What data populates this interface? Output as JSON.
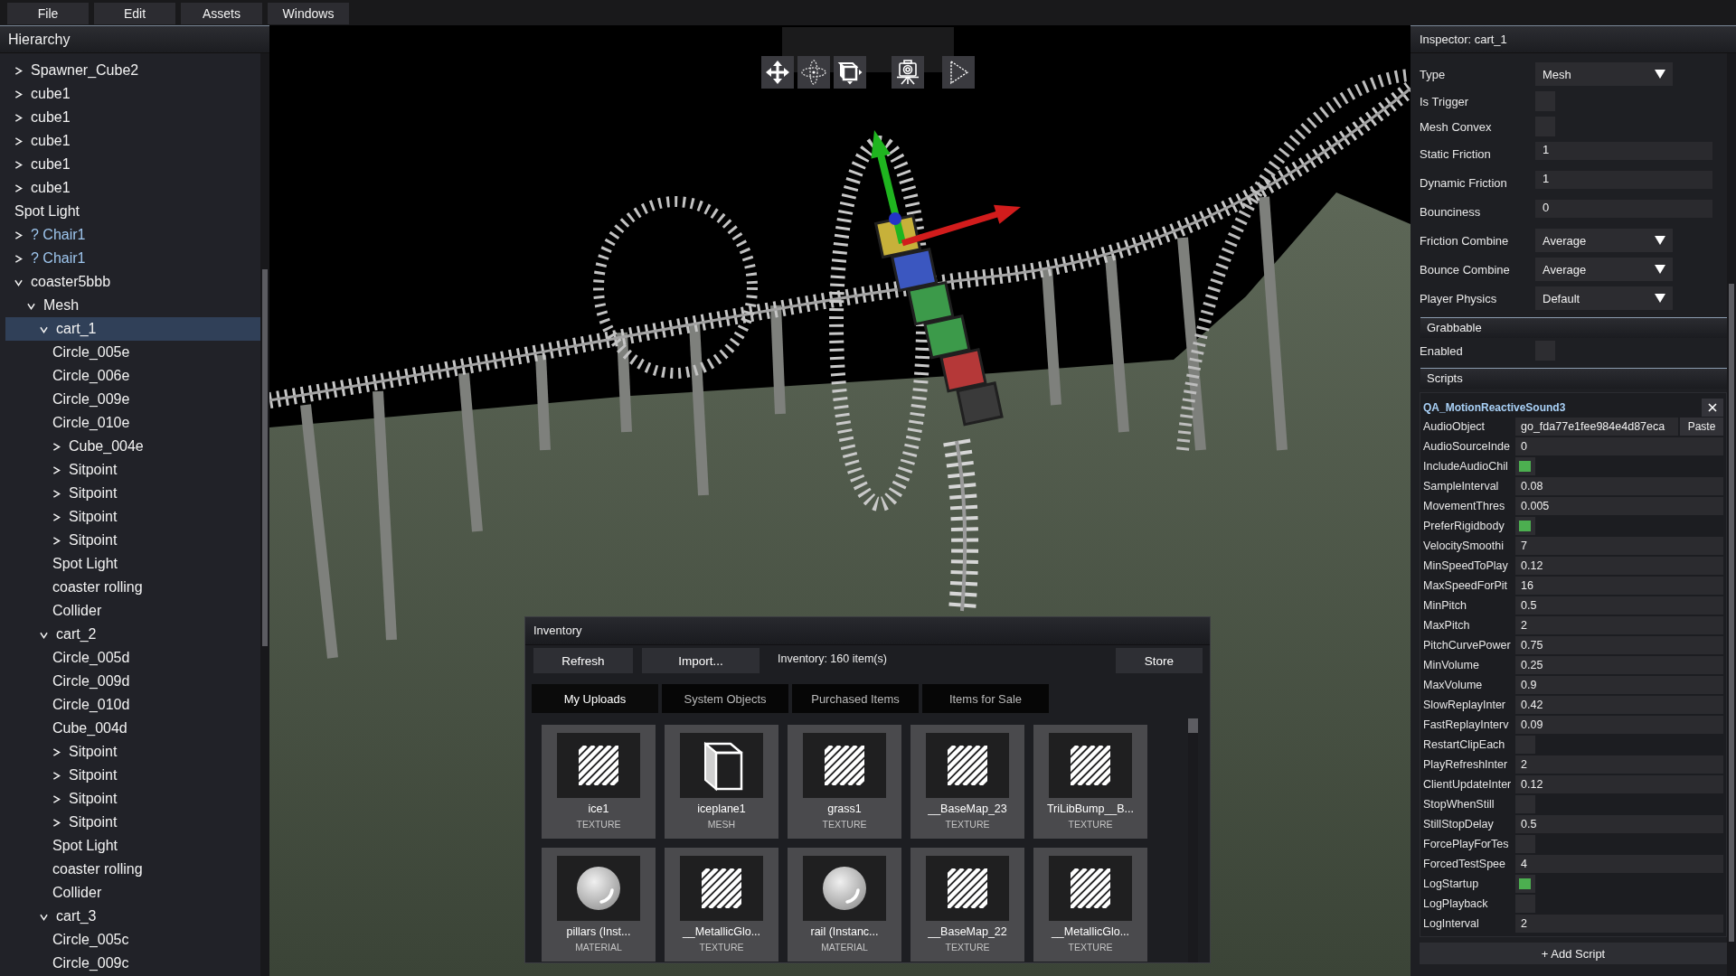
{
  "menu_bar": {
    "items": [
      "File",
      "Edit",
      "Assets",
      "Windows"
    ]
  },
  "hierarchy": {
    "title": "Hierarchy",
    "items": [
      {
        "label": "Spawner_Cube2",
        "expanded": false,
        "selected": false,
        "color": "#f2f2f2"
      },
      {
        "label": "cube1",
        "expanded": false,
        "selected": false,
        "color": "#f2f2f2"
      },
      {
        "label": "cube1",
        "expanded": false,
        "selected": false,
        "color": "#f2f2f2"
      },
      {
        "label": "cube1",
        "expanded": false,
        "selected": false,
        "color": "#f2f2f2"
      },
      {
        "label": "cube1",
        "expanded": false,
        "selected": false,
        "color": "#f2f2f2"
      },
      {
        "label": "cube1",
        "expanded": false,
        "selected": false,
        "color": "#f2f2f2"
      },
      {
        "label": "Spot Light",
        "selected": false,
        "color": "#f2f2f2"
      },
      {
        "label": "? Chair1",
        "expanded": false,
        "selected": false,
        "color": "#9ec6ee"
      },
      {
        "label": "? Chair1",
        "expanded": false,
        "selected": false,
        "color": "#9ec6ee"
      },
      {
        "label": "coaster5bbb",
        "expanded": true,
        "selected": false,
        "color": "#f2f2f2",
        "children": [
          {
            "label": "Mesh",
            "expanded": true,
            "selected": false,
            "children": [
              {
                "label": "cart_1",
                "expanded": true,
                "selected": true,
                "children": [
                  {
                    "label": "Circle_005e",
                    "selected": false
                  },
                  {
                    "label": "Circle_006e",
                    "selected": false
                  },
                  {
                    "label": "Circle_009e",
                    "selected": false
                  },
                  {
                    "label": "Circle_010e",
                    "selected": false
                  },
                  {
                    "label": "Cube_004e",
                    "expanded": false,
                    "selected": false
                  },
                  {
                    "label": "Sitpoint",
                    "expanded": false,
                    "selected": false
                  },
                  {
                    "label": "Sitpoint",
                    "expanded": false,
                    "selected": false
                  },
                  {
                    "label": "Sitpoint",
                    "expanded": false,
                    "selected": false
                  },
                  {
                    "label": "Sitpoint",
                    "expanded": false,
                    "selected": false
                  },
                  {
                    "label": "Spot Light",
                    "selected": false
                  },
                  {
                    "label": "coaster rolling",
                    "selected": false
                  },
                  {
                    "label": "Collider",
                    "selected": false
                  }
                ]
              },
              {
                "label": "cart_2",
                "expanded": true,
                "selected": false,
                "children": [
                  {
                    "label": "Circle_005d",
                    "selected": false
                  },
                  {
                    "label": "Circle_009d",
                    "selected": false
                  },
                  {
                    "label": "Circle_010d",
                    "selected": false
                  },
                  {
                    "label": "Cube_004d",
                    "selected": false
                  },
                  {
                    "label": "Sitpoint",
                    "expanded": false,
                    "selected": false
                  },
                  {
                    "label": "Sitpoint",
                    "expanded": false,
                    "selected": false
                  },
                  {
                    "label": "Sitpoint",
                    "expanded": false,
                    "selected": false
                  },
                  {
                    "label": "Sitpoint",
                    "expanded": false,
                    "selected": false
                  },
                  {
                    "label": "Spot Light",
                    "selected": false
                  },
                  {
                    "label": "coaster rolling",
                    "selected": false
                  },
                  {
                    "label": "Collider",
                    "selected": false
                  }
                ]
              },
              {
                "label": "cart_3",
                "expanded": true,
                "selected": false,
                "children": [
                  {
                    "label": "Circle_005c",
                    "selected": false
                  },
                  {
                    "label": "Circle_009c",
                    "selected": false
                  }
                ]
              }
            ]
          }
        ]
      }
    ]
  },
  "inspector": {
    "title": "Inspector: cart_1",
    "properties": [
      {
        "label": "Type",
        "kind": "dropdown",
        "value": "Mesh"
      },
      {
        "label": "Is Trigger",
        "kind": "checkbox",
        "checked": false
      },
      {
        "label": "Mesh Convex",
        "kind": "checkbox",
        "checked": false
      },
      {
        "label": "Static Friction",
        "kind": "text",
        "value": "1"
      },
      {
        "label": "Dynamic Friction",
        "kind": "text",
        "value": "1"
      },
      {
        "label": "Bounciness",
        "kind": "text",
        "value": "0"
      },
      {
        "label": "Friction Combine",
        "kind": "dropdown",
        "value": "Average"
      },
      {
        "label": "Bounce Combine",
        "kind": "dropdown",
        "value": "Average"
      },
      {
        "label": "Player Physics",
        "kind": "dropdown",
        "value": "Default"
      }
    ],
    "sections": [
      {
        "title": "Grabbable",
        "properties": [
          {
            "label": "Enabled",
            "kind": "checkbox",
            "checked": false
          }
        ]
      }
    ],
    "scripts": {
      "title": "Scripts",
      "items": [
        {
          "name": "QA_MotionReactiveSound3",
          "fields": [
            {
              "label": "AudioObject",
              "kind": "object",
              "value": "go_fda77e1fee984e4d87eca",
              "button": "Paste"
            },
            {
              "label": "AudioSourceInde",
              "kind": "text",
              "value": "0"
            },
            {
              "label": "IncludeAudioChil",
              "kind": "checkbox",
              "checked": true
            },
            {
              "label": "SampleInterval",
              "kind": "text",
              "value": "0.08"
            },
            {
              "label": "MovementThres",
              "kind": "text",
              "value": "0.005"
            },
            {
              "label": "PreferRigidbody",
              "kind": "checkbox",
              "checked": true
            },
            {
              "label": "VelocitySmoothi",
              "kind": "text",
              "value": "7"
            },
            {
              "label": "MinSpeedToPlay",
              "kind": "text",
              "value": "0.12"
            },
            {
              "label": "MaxSpeedForPit",
              "kind": "text",
              "value": "16"
            },
            {
              "label": "MinPitch",
              "kind": "text",
              "value": "0.5"
            },
            {
              "label": "MaxPitch",
              "kind": "text",
              "value": "2"
            },
            {
              "label": "PitchCurvePower",
              "kind": "text",
              "value": "0.75"
            },
            {
              "label": "MinVolume",
              "kind": "text",
              "value": "0.25"
            },
            {
              "label": "MaxVolume",
              "kind": "text",
              "value": "0.9"
            },
            {
              "label": "SlowReplayInter",
              "kind": "text",
              "value": "0.42"
            },
            {
              "label": "FastReplayInterv",
              "kind": "text",
              "value": "0.09"
            },
            {
              "label": "RestartClipEach",
              "kind": "checkbox",
              "checked": false
            },
            {
              "label": "PlayRefreshInter",
              "kind": "text",
              "value": "2"
            },
            {
              "label": "ClientUpdateInter",
              "kind": "text",
              "value": "0.12"
            },
            {
              "label": "StopWhenStill",
              "kind": "checkbox",
              "checked": false
            },
            {
              "label": "StillStopDelay",
              "kind": "text",
              "value": "0.5"
            },
            {
              "label": "ForcePlayForTes",
              "kind": "checkbox",
              "checked": false
            },
            {
              "label": "ForcedTestSpee",
              "kind": "text",
              "value": "4"
            },
            {
              "label": "LogStartup",
              "kind": "checkbox",
              "checked": true
            },
            {
              "label": "LogPlayback",
              "kind": "checkbox",
              "checked": false
            },
            {
              "label": "LogInterval",
              "kind": "text",
              "value": "2"
            }
          ]
        }
      ],
      "add_button": "+ Add Script"
    }
  },
  "inventory": {
    "title": "Inventory",
    "buttons": [
      "Refresh",
      "Import..."
    ],
    "count": "Inventory: 160 item(s)",
    "store_button": "Store",
    "tabs": [
      {
        "label": "My Uploads",
        "selected": true
      },
      {
        "label": "System Objects",
        "selected": false
      },
      {
        "label": "Purchased Items",
        "selected": false
      },
      {
        "label": "Items for Sale",
        "selected": false
      }
    ],
    "items": [
      {
        "name": "ice1",
        "type": "TEXTURE",
        "kind": "texture"
      },
      {
        "name": "iceplane1",
        "type": "MESH",
        "kind": "mesh"
      },
      {
        "name": "grass1",
        "type": "TEXTURE",
        "kind": "texture"
      },
      {
        "name": "__BaseMap_23",
        "type": "TEXTURE",
        "kind": "texture"
      },
      {
        "name": "TriLibBump__B...",
        "type": "TEXTURE",
        "kind": "texture"
      },
      {
        "name": "pillars (Inst...",
        "type": "MATERIAL",
        "kind": "material"
      },
      {
        "name": "__MetallicGlo...",
        "type": "TEXTURE",
        "kind": "texture"
      },
      {
        "name": "rail (Instanc...",
        "type": "MATERIAL",
        "kind": "material"
      },
      {
        "name": "__BaseMap_22",
        "type": "TEXTURE",
        "kind": "texture"
      },
      {
        "name": "__MetallicGlo...",
        "type": "TEXTURE",
        "kind": "texture"
      }
    ]
  }
}
